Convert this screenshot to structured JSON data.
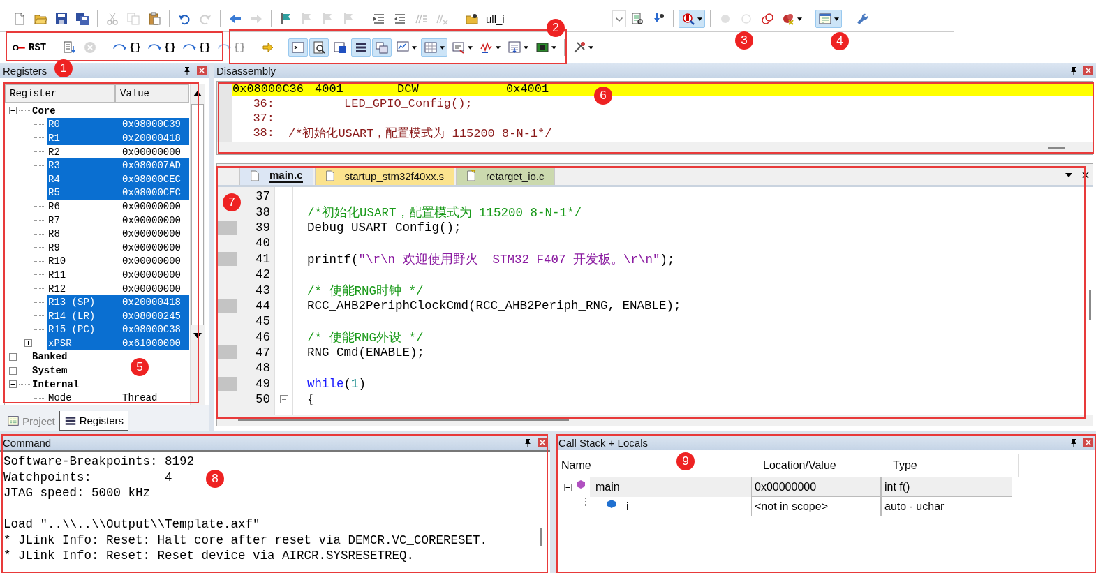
{
  "toolbar": {
    "rows": [
      [
        {
          "kind": "button",
          "pressed": false,
          "disabled": false,
          "dropdown": false
        },
        {
          "kind": "button",
          "pressed": false,
          "disabled": false,
          "dropdown": false
        },
        {
          "kind": "button",
          "pressed": false,
          "disabled": false,
          "dropdown": false
        },
        {
          "kind": "button",
          "pressed": false,
          "disabled": false,
          "dropdown": false
        },
        {
          "kind": "separator"
        },
        {
          "kind": "button",
          "pressed": false,
          "disabled": true,
          "dropdown": false
        },
        {
          "kind": "button",
          "pressed": false,
          "disabled": true,
          "dropdown": false
        },
        {
          "kind": "button",
          "pressed": false,
          "disabled": false,
          "dropdown": false
        },
        {
          "kind": "separator"
        },
        {
          "kind": "button",
          "pressed": false,
          "disabled": false,
          "dropdown": false
        },
        {
          "kind": "button",
          "pressed": false,
          "disabled": true,
          "dropdown": false
        },
        {
          "kind": "separator"
        },
        {
          "kind": "button",
          "pressed": false,
          "disabled": false,
          "dropdown": false
        },
        {
          "kind": "button",
          "pressed": false,
          "disabled": true,
          "dropdown": false
        },
        {
          "kind": "separator"
        },
        {
          "kind": "button",
          "pressed": false,
          "disabled": false,
          "dropdown": false
        },
        {
          "kind": "button",
          "pressed": false,
          "disabled": true,
          "dropdown": false
        },
        {
          "kind": "button",
          "pressed": false,
          "disabled": true,
          "dropdown": false
        },
        {
          "kind": "button",
          "pressed": false,
          "disabled": true,
          "dropdown": false
        },
        {
          "kind": "separator"
        },
        {
          "kind": "button",
          "pressed": false,
          "disabled": false,
          "dropdown": false
        },
        {
          "kind": "button",
          "pressed": false,
          "disabled": false,
          "dropdown": false
        },
        {
          "kind": "button",
          "pressed": false,
          "disabled": true,
          "dropdown": false
        },
        {
          "kind": "button",
          "pressed": false,
          "disabled": true,
          "dropdown": false
        },
        {
          "kind": "separator"
        },
        {
          "kind": "button",
          "pressed": false,
          "disabled": false,
          "dropdown": false
        },
        {
          "kind": "combo",
          "value": "ull_i"
        },
        {
          "kind": "button",
          "pressed": false,
          "disabled": false,
          "dropdown": false
        },
        {
          "kind": "button",
          "pressed": false,
          "disabled": false,
          "dropdown": false
        },
        {
          "kind": "separator"
        },
        {
          "kind": "button",
          "pressed": true,
          "disabled": false,
          "dropdown": true
        },
        {
          "kind": "separator"
        },
        {
          "kind": "button",
          "pressed": false,
          "disabled": true,
          "dropdown": false
        },
        {
          "kind": "button",
          "pressed": false,
          "disabled": true,
          "dropdown": false
        },
        {
          "kind": "button",
          "pressed": false,
          "disabled": false,
          "dropdown": false
        },
        {
          "kind": "button",
          "pressed": false,
          "disabled": false,
          "dropdown": true
        },
        {
          "kind": "separator"
        },
        {
          "kind": "button",
          "pressed": true,
          "disabled": false,
          "dropdown": true
        },
        {
          "kind": "separator"
        },
        {
          "kind": "button",
          "pressed": false,
          "disabled": false,
          "dropdown": false
        }
      ],
      [
        {
          "kind": "button",
          "label": "RST",
          "pressed": false,
          "disabled": false,
          "dropdown": false
        },
        {
          "kind": "separator"
        },
        {
          "kind": "button",
          "pressed": false,
          "disabled": false,
          "dropdown": false
        },
        {
          "kind": "button",
          "pressed": false,
          "disabled": true,
          "dropdown": false
        },
        {
          "kind": "separator"
        },
        {
          "kind": "button",
          "label": "{}",
          "pressed": false,
          "disabled": false,
          "dropdown": false
        },
        {
          "kind": "button",
          "label": "{}",
          "pressed": false,
          "disabled": false,
          "dropdown": false
        },
        {
          "kind": "button",
          "label": "{}",
          "pressed": false,
          "disabled": false,
          "dropdown": false
        },
        {
          "kind": "button",
          "label": "{}",
          "pressed": false,
          "disabled": true,
          "dropdown": false
        },
        {
          "kind": "separator"
        },
        {
          "kind": "button",
          "pressed": false,
          "disabled": false,
          "dropdown": false
        },
        {
          "kind": "separator"
        },
        {
          "kind": "button",
          "pressed": true,
          "disabled": false,
          "dropdown": false
        },
        {
          "kind": "button",
          "pressed": true,
          "disabled": false,
          "dropdown": false
        },
        {
          "kind": "button",
          "pressed": false,
          "disabled": false,
          "dropdown": false
        },
        {
          "kind": "button",
          "pressed": true,
          "disabled": false,
          "dropdown": false
        },
        {
          "kind": "button",
          "pressed": true,
          "disabled": false,
          "dropdown": false
        },
        {
          "kind": "button",
          "pressed": false,
          "disabled": false,
          "dropdown": true
        },
        {
          "kind": "button",
          "pressed": true,
          "disabled": false,
          "dropdown": true
        },
        {
          "kind": "button",
          "pressed": false,
          "disabled": false,
          "dropdown": true
        },
        {
          "kind": "button",
          "pressed": false,
          "disabled": false,
          "dropdown": true
        },
        {
          "kind": "button",
          "pressed": false,
          "disabled": false,
          "dropdown": true
        },
        {
          "kind": "button",
          "pressed": false,
          "disabled": false,
          "dropdown": true
        },
        {
          "kind": "separator"
        },
        {
          "kind": "button",
          "pressed": false,
          "disabled": false,
          "dropdown": true
        }
      ]
    ]
  },
  "registers": {
    "title": "Registers",
    "columns": [
      "Register",
      "Value"
    ],
    "groups": [
      {
        "name": "Core",
        "expanded": true,
        "children": [
          {
            "name": "R0",
            "value": "0x08000C39",
            "changed": true
          },
          {
            "name": "R1",
            "value": "0x20000418",
            "changed": true
          },
          {
            "name": "R2",
            "value": "0x00000000",
            "changed": false
          },
          {
            "name": "R3",
            "value": "0x080007AD",
            "changed": true
          },
          {
            "name": "R4",
            "value": "0x08000CEC",
            "changed": true
          },
          {
            "name": "R5",
            "value": "0x08000CEC",
            "changed": true
          },
          {
            "name": "R6",
            "value": "0x00000000",
            "changed": false
          },
          {
            "name": "R7",
            "value": "0x00000000",
            "changed": false
          },
          {
            "name": "R8",
            "value": "0x00000000",
            "changed": false
          },
          {
            "name": "R9",
            "value": "0x00000000",
            "changed": false
          },
          {
            "name": "R10",
            "value": "0x00000000",
            "changed": false
          },
          {
            "name": "R11",
            "value": "0x00000000",
            "changed": false
          },
          {
            "name": "R12",
            "value": "0x00000000",
            "changed": false
          },
          {
            "name": "R13 (SP)",
            "value": "0x20000418",
            "changed": true
          },
          {
            "name": "R14 (LR)",
            "value": "0x08000245",
            "changed": true
          },
          {
            "name": "R15 (PC)",
            "value": "0x08000C38",
            "changed": true
          },
          {
            "name": "xPSR",
            "value": "0x61000000",
            "changed": true,
            "expanded": false
          }
        ]
      },
      {
        "name": "Banked",
        "expanded": false
      },
      {
        "name": "System",
        "expanded": false
      },
      {
        "name": "Internal",
        "expanded": true,
        "children": [
          {
            "name": "Mode",
            "value": "Thread",
            "changed": false
          }
        ]
      }
    ]
  },
  "left_tabs": [
    {
      "label": "Project",
      "selected": false
    },
    {
      "label": "Registers",
      "selected": true
    }
  ],
  "disassembly": {
    "title": "Disassembly",
    "lines": [
      {
        "kind": "instruction",
        "address": "0x08000C36",
        "opcode": "4001",
        "mnemonic": "DCW",
        "operand": "0x4001",
        "current": true
      },
      {
        "kind": "source",
        "line": "36:",
        "code": "LED_GPIO_Config();"
      },
      {
        "kind": "source",
        "line": "37:"
      },
      {
        "kind": "source",
        "line": "38:",
        "code": "/*初始化USART，配置模式为 115200 8-N-1*/"
      }
    ]
  },
  "editor": {
    "tabs": [
      {
        "label": "main.c",
        "selected": true,
        "color": "#dce6f4"
      },
      {
        "label": "startup_stm32f40xx.s",
        "selected": false,
        "color": "#fbe38e"
      },
      {
        "label": "retarget_io.c",
        "selected": false,
        "color": "#cbd9ae"
      }
    ],
    "lines": [
      {
        "number": "37",
        "executable": false
      },
      {
        "number": "38",
        "executable": false,
        "tokens": [
          {
            "kind": "comment",
            "text": "/*初始化USART，配置模式为 115200 8-N-1*/"
          }
        ]
      },
      {
        "number": "39",
        "executable": true,
        "tokens": [
          {
            "kind": "plain",
            "text": "Debug_USART_Config();"
          }
        ]
      },
      {
        "number": "40",
        "executable": false
      },
      {
        "number": "41",
        "executable": true,
        "tokens": [
          {
            "kind": "plain",
            "text": "printf("
          },
          {
            "kind": "string",
            "text": "\"\\r\\n 欢迎使用野火  STM32 F407 开发板。\\r\\n\""
          },
          {
            "kind": "plain",
            "text": ");"
          }
        ]
      },
      {
        "number": "42",
        "executable": false
      },
      {
        "number": "43",
        "executable": false,
        "tokens": [
          {
            "kind": "comment",
            "text": "/* 使能RNG时钟 */"
          }
        ]
      },
      {
        "number": "44",
        "executable": true,
        "tokens": [
          {
            "kind": "plain",
            "text": "RCC_AHB2PeriphClockCmd(RCC_AHB2Periph_RNG, ENABLE);"
          }
        ]
      },
      {
        "number": "45",
        "executable": false
      },
      {
        "number": "46",
        "executable": false,
        "tokens": [
          {
            "kind": "comment",
            "text": "/* 使能RNG外设 */"
          }
        ]
      },
      {
        "number": "47",
        "executable": true,
        "tokens": [
          {
            "kind": "plain",
            "text": "RNG_Cmd(ENABLE);"
          }
        ]
      },
      {
        "number": "48",
        "executable": false
      },
      {
        "number": "49",
        "executable": true,
        "tokens": [
          {
            "kind": "keyword",
            "text": "while"
          },
          {
            "kind": "plain",
            "text": "("
          },
          {
            "kind": "number",
            "text": "1"
          },
          {
            "kind": "plain",
            "text": ")"
          }
        ]
      },
      {
        "number": "50",
        "executable": false,
        "foldable": true,
        "tokens": [
          {
            "kind": "plain",
            "text": "{"
          }
        ]
      }
    ]
  },
  "command": {
    "title": "Command",
    "blocks": [
      [
        "Software-Breakpoints: 8192",
        "Watchpoints:          4",
        "JTAG speed: 5000 kHz"
      ],
      [
        "Load \"..\\\\..\\\\Output\\\\Template.axf\"",
        "* JLink Info: Reset: Halt core after reset via DEMCR.VC_CORERESET.",
        "* JLink Info: Reset: Reset device via AIRCR.SYSRESETREQ."
      ]
    ]
  },
  "call_stack": {
    "title": "Call Stack + Locals",
    "columns": [
      "Name",
      "Location/Value",
      "Type"
    ],
    "rows": [
      {
        "name": "main",
        "kind": "function",
        "location": "0x00000000",
        "type": "int f()",
        "selected": true,
        "expanded": true,
        "children": [
          {
            "name": "i",
            "kind": "variable",
            "location": "<not in scope>",
            "type": "auto - uchar",
            "selected": false
          }
        ]
      }
    ]
  },
  "annotations": [
    {
      "number": "1",
      "boxed": true
    },
    {
      "number": "2",
      "boxed": true
    },
    {
      "number": "3",
      "boxed": false
    },
    {
      "number": "4",
      "boxed": false
    },
    {
      "number": "5",
      "boxed": true
    },
    {
      "number": "6",
      "boxed": true
    },
    {
      "number": "7",
      "boxed": true
    },
    {
      "number": "8",
      "boxed": true
    },
    {
      "number": "9",
      "boxed": true
    }
  ]
}
